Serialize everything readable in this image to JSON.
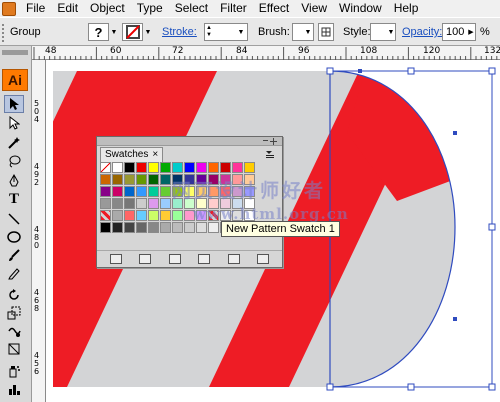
{
  "menubar": {
    "items": [
      "File",
      "Edit",
      "Object",
      "Type",
      "Select",
      "Filter",
      "Effect",
      "View",
      "Window",
      "Help"
    ]
  },
  "controlbar": {
    "selection_label": "Group",
    "fill_value": "?",
    "stroke_label": "Stroke:",
    "brush_label": "Brush:",
    "style_label": "Style:",
    "opacity_label": "Opacity:",
    "opacity_value": "100",
    "opacity_unit": "%"
  },
  "ruler": {
    "labels": [
      "48",
      "60",
      "72",
      "84",
      "96",
      "108",
      "120",
      "132"
    ],
    "vertical_labels": [
      "5\n0\n4",
      "4\n9\n2",
      "4\n8\n0",
      "4\n6\n8",
      "4\n5\n6"
    ]
  },
  "tools": {
    "logo": "Ai"
  },
  "swatches": {
    "tab_label": "Swatches",
    "tab_close": "×",
    "tooltip": "New Pattern Swatch 1"
  },
  "watermark": {
    "line1": "网页设计师好者",
    "line2": "www.html.org.cn"
  },
  "colors": {
    "stripe_red": "#ee1c25",
    "background_gray": "#d3d4d6",
    "selection_blue": "#2f4bbf",
    "accent_orange": "#ff7a00"
  }
}
